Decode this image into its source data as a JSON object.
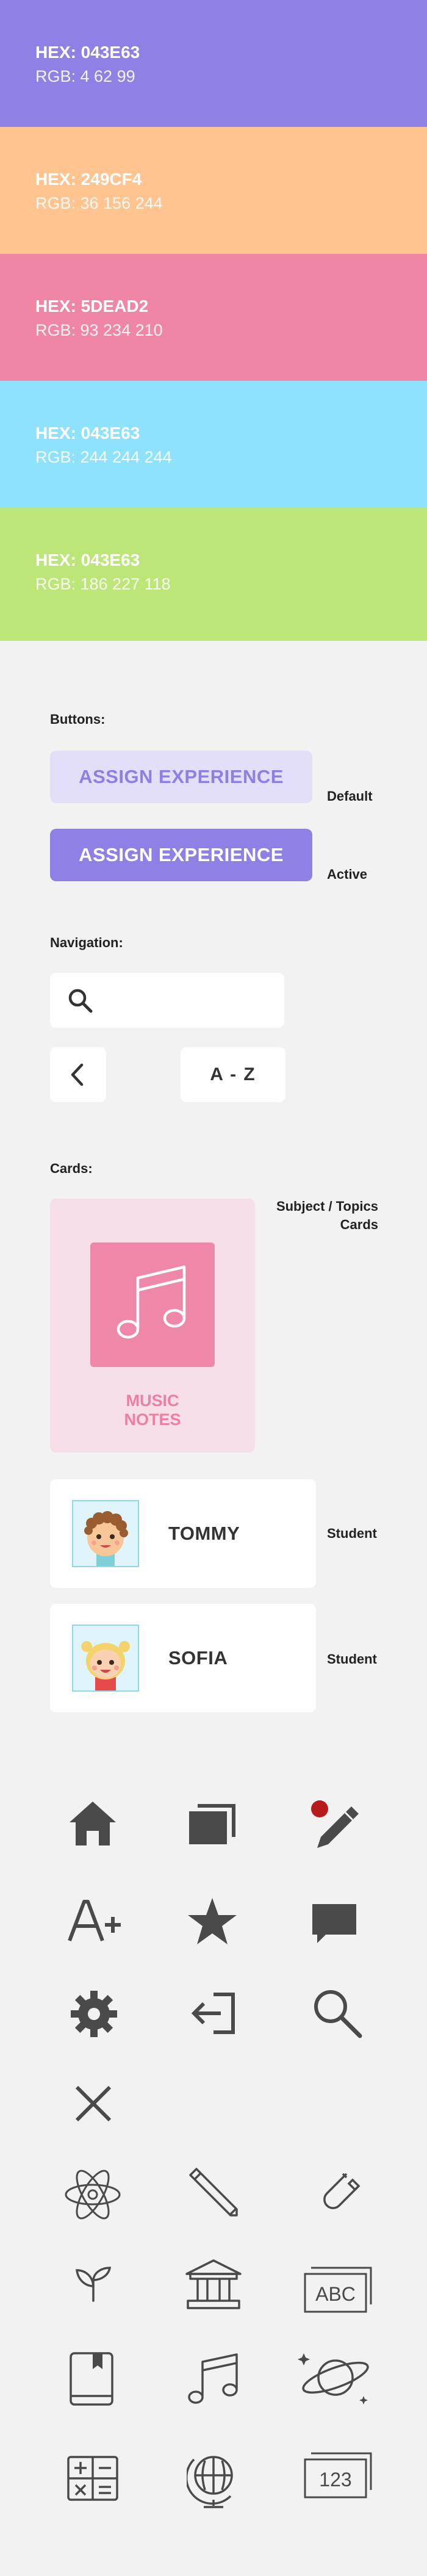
{
  "swatches": [
    {
      "hex": "HEX: 043E63",
      "rgb": "RGB: 4 62 99",
      "color": "#8f80e6"
    },
    {
      "hex": "HEX: 249CF4",
      "rgb": "RGB: 36 156 244",
      "color": "#ffc48f"
    },
    {
      "hex": "HEX: 5DEAD2",
      "rgb": "RGB: 93 234 210",
      "color": "#ef86a4"
    },
    {
      "hex": "HEX: 043E63",
      "rgb": "RGB: 244 244 244",
      "color": "#8fe2fb"
    },
    {
      "hex": "HEX: 043E63",
      "rgb": "RGB: 186 227 118",
      "color": "#bce677"
    }
  ],
  "buttons": {
    "section_label": "Buttons:",
    "default_label": "ASSIGN EXPERIENCE",
    "default_caption": "Default",
    "active_label": "ASSIGN EXPERIENCE",
    "active_caption": "Active"
  },
  "navigation": {
    "section_label": "Navigation:",
    "az_label": "A - Z"
  },
  "cards": {
    "section_label": "Cards:",
    "subject_caption": "Subject / Topics\nCards",
    "subject_name": "MUSIC\nNOTES",
    "students": [
      {
        "name": "TOMMY",
        "caption": "Student"
      },
      {
        "name": "SOFIA",
        "caption": "Student"
      }
    ]
  },
  "icons": {
    "system": [
      "home-icon",
      "layers-icon",
      "edit-notification-icon",
      "grade-icon",
      "star-icon",
      "chat-icon",
      "settings-icon",
      "logout-icon",
      "search-icon",
      "close-icon"
    ],
    "subjects": [
      "atom-icon",
      "pencil-icon",
      "magnet-icon",
      "sprout-icon",
      "museum-icon",
      "abc-board-icon",
      "book-icon",
      "music-notes-icon",
      "planet-icon",
      "calculator-icon",
      "globe-icon",
      "numbers-board-icon"
    ],
    "accent_color": "#b71c1c",
    "icon_color": "#4a4a4a"
  }
}
